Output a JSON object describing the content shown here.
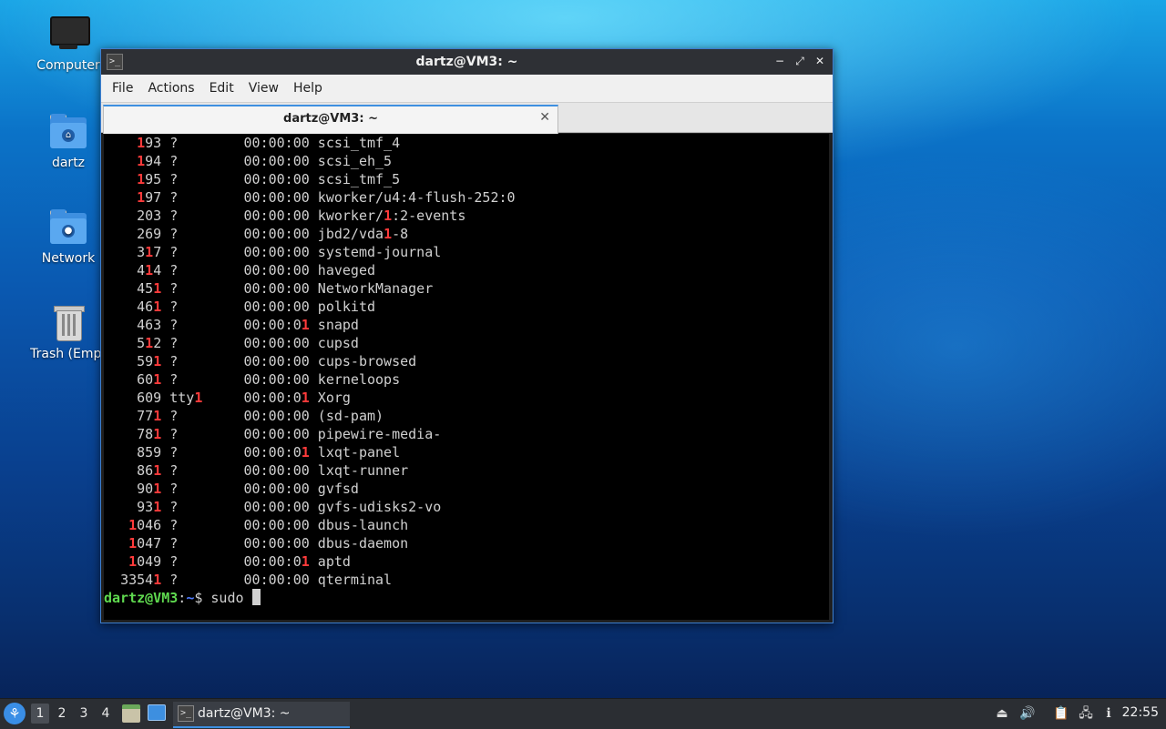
{
  "desktop": {
    "icons": [
      {
        "label": "Computer"
      },
      {
        "label": "dartz"
      },
      {
        "label": "Network"
      },
      {
        "label": "Trash (Empt"
      }
    ]
  },
  "window": {
    "title": "dartz@VM3: ~",
    "icon_glyph": ">_",
    "buttons": {
      "minimize": "−",
      "maximize": "⤢",
      "close": "✕"
    },
    "menu": [
      "File",
      "Actions",
      "Edit",
      "View",
      "Help"
    ],
    "tab": {
      "label": "dartz@VM3: ~",
      "close": "✕"
    }
  },
  "terminal": {
    "highlight_color": "#ff3b3b",
    "lines": [
      "    193 ?        00:00:00 scsi_tmf_4",
      "    194 ?        00:00:00 scsi_eh_5",
      "    195 ?        00:00:00 scsi_tmf_5",
      "    197 ?        00:00:00 kworker/u4:4-flush-252:0",
      "    203 ?        00:00:00 kworker/1:2-events",
      "    269 ?        00:00:00 jbd2/vda1-8",
      "    317 ?        00:00:00 systemd-journal",
      "    414 ?        00:00:00 haveged",
      "    451 ?        00:00:00 NetworkManager",
      "    461 ?        00:00:00 polkitd",
      "    463 ?        00:00:01 snapd",
      "    512 ?        00:00:00 cupsd",
      "    591 ?        00:00:00 cups-browsed",
      "    601 ?        00:00:00 kerneloops",
      "    609 tty1     00:00:01 Xorg",
      "    771 ?        00:00:00 (sd-pam)",
      "    781 ?        00:00:00 pipewire-media-",
      "    859 ?        00:00:01 lxqt-panel",
      "    861 ?        00:00:00 lxqt-runner",
      "    901 ?        00:00:00 gvfsd",
      "    931 ?        00:00:00 gvfs-udisks2-vo",
      "   1046 ?        00:00:00 dbus-launch",
      "   1047 ?        00:00:00 dbus-daemon",
      "   1049 ?        00:00:01 aptd",
      "  33541 ?        00:00:00 qterminal"
    ],
    "prompt": {
      "user_host": "dartz@VM3",
      "sep": ":",
      "path": "~",
      "symbol": "$ ",
      "input": "sudo "
    }
  },
  "taskbar": {
    "start_glyph": "⚘",
    "desktops": [
      "1",
      "2",
      "3",
      "4"
    ],
    "active_desktop": "1",
    "task": {
      "label": "dartz@VM3: ~",
      "icon_glyph": ">_"
    },
    "tray": {
      "eject": "⏏",
      "volume": "🔊",
      "clipboard": "📋",
      "network": "🖧",
      "update": "ℹ"
    },
    "clock": "22:55"
  }
}
